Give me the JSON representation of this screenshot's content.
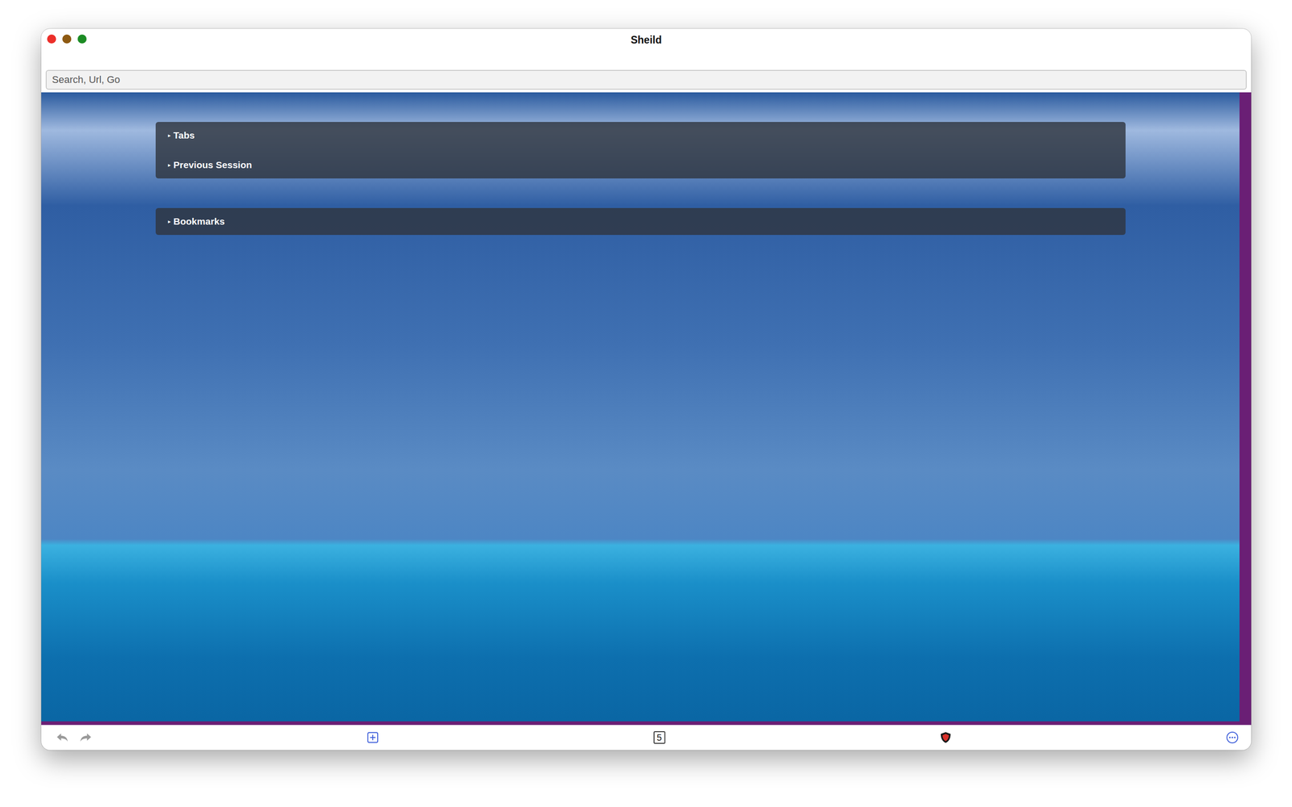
{
  "window": {
    "title": "Sheild"
  },
  "search": {
    "placeholder": "Search, Url, Go"
  },
  "sections": [
    {
      "items": [
        {
          "marker": "▸",
          "label": "Tabs",
          "expanded": false
        },
        {
          "marker": "▸",
          "label": "Previous Session",
          "expanded": false
        }
      ]
    },
    {
      "items": [
        {
          "marker": "▸",
          "label": "Bookmarks",
          "expanded": false
        }
      ]
    }
  ],
  "toolbar": {
    "tab_count": "5"
  }
}
